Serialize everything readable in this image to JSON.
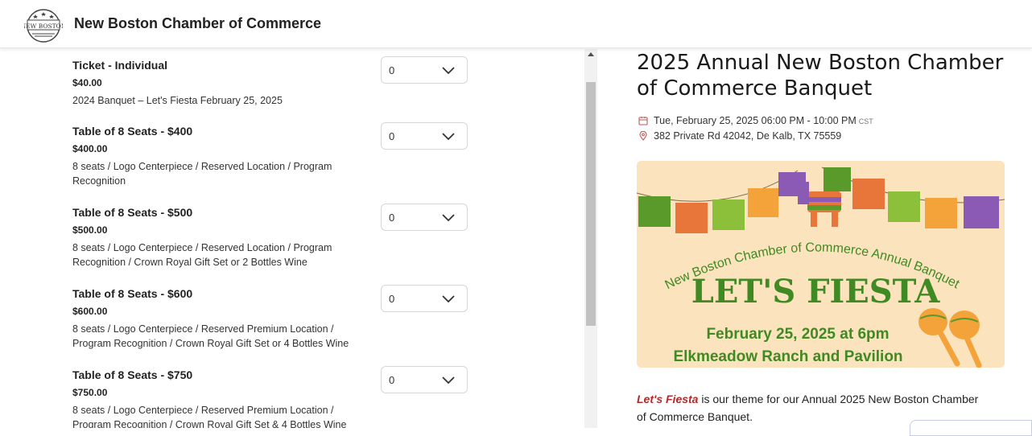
{
  "header": {
    "org_name": "New Boston Chamber of Commerce",
    "logo_text": "NEW BOSTON"
  },
  "tickets": [
    {
      "name": "Ticket - Individual",
      "price": "$40.00",
      "description": "2024 Banquet – Let's Fiesta February 25, 2025",
      "quantity": "0"
    },
    {
      "name": "Table of 8 Seats - $400",
      "price": "$400.00",
      "description": "8 seats / Logo Centerpiece / Reserved Location / Program Recognition",
      "quantity": "0"
    },
    {
      "name": "Table of 8 Seats - $500",
      "price": "$500.00",
      "description": "8 seats / Logo Centerpiece / Reserved Location / Program Recognition / Crown Royal Gift Set or 2 Bottles Wine",
      "quantity": "0"
    },
    {
      "name": "Table of 8 Seats - $600",
      "price": "$600.00",
      "description": "8 seats / Logo Centerpiece / Reserved Premium Location / Program Recognition / Crown Royal Gift Set or 4 Bottles Wine",
      "quantity": "0"
    },
    {
      "name": "Table of 8 Seats - $750",
      "price": "$750.00",
      "description": "8 seats / Logo Centerpiece / Reserved Premium Location / Program Recognition / Crown Royal Gift Set & 4 Bottles Wine",
      "quantity": "0"
    }
  ],
  "event": {
    "title": "2025 Annual New Boston Chamber of Commerce Banquet",
    "datetime": "Tue, February 25, 2025 06:00 PM - 10:00 PM",
    "timezone": "CST",
    "address": "382 Private Rd 42042, De Kalb, TX 75559",
    "banner": {
      "arc_text": "New Boston Chamber of Commerce Annual Banquet",
      "headline": "LET'S FIESTA",
      "date_line": "February 25, 2025 at 6pm",
      "venue_line": "Elkmeadow Ranch and Pavilion"
    },
    "description_theme": "Let's Fiesta",
    "description_rest": " is our theme for our Annual 2025 New Boston Chamber of Commerce Banquet."
  },
  "icons": {
    "calendar": "calendar-icon",
    "location": "map-pin-icon",
    "dropdown": "chevron-down-icon"
  },
  "colors": {
    "banner_bg": "#fbe3bd",
    "banner_green": "#3f8a22",
    "theme_red": "#b12a2a"
  }
}
